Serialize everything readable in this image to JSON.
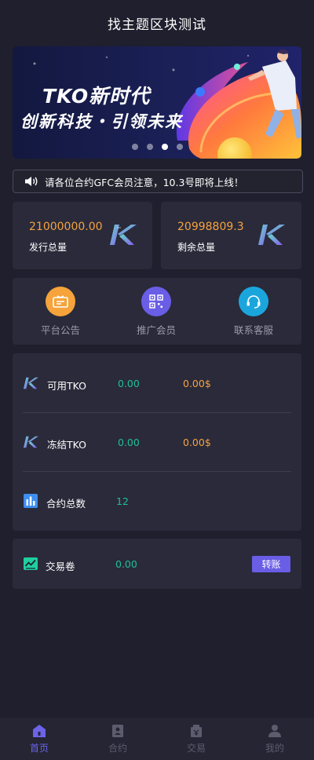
{
  "header": {
    "title": "找主题区块测试"
  },
  "banner": {
    "line1": "TKO新时代",
    "line2": "创新科技・引领未来",
    "slides": 4,
    "active_slide": 3
  },
  "notice": {
    "icon": "speaker-icon",
    "text": "请各位合约GFC会员注意，10.3号即将上线！"
  },
  "stats": [
    {
      "value": "21000000.00",
      "label": "发行总量",
      "icon": "tko-logo-icon"
    },
    {
      "value": "20998809.3",
      "label": "剩余总量",
      "icon": "tko-logo-icon"
    }
  ],
  "menu": [
    {
      "label": "平台公告",
      "icon": "announcement-icon",
      "color": "#f5a33a"
    },
    {
      "label": "推广会员",
      "icon": "qrcode-icon",
      "color": "#6a5de6"
    },
    {
      "label": "联系客服",
      "icon": "headset-icon",
      "color": "#1aa6dd"
    }
  ],
  "assets": {
    "available": {
      "name": "可用TKO",
      "amount": "0.00",
      "usd": "0.00$"
    },
    "frozen": {
      "name": "冻结TKO",
      "amount": "0.00",
      "usd": "0.00$"
    },
    "contracts": {
      "name": "合约总数",
      "count": "12"
    }
  },
  "voucher": {
    "name": "交易卷",
    "amount": "0.00",
    "button": "转账"
  },
  "tabs": [
    {
      "label": "首页",
      "icon": "home-icon",
      "active": true
    },
    {
      "label": "合约",
      "icon": "contract-icon",
      "active": false
    },
    {
      "label": "交易",
      "icon": "trade-icon",
      "active": false
    },
    {
      "label": "我的",
      "icon": "user-icon",
      "active": false
    }
  ],
  "colors": {
    "background": "#1f1f2e",
    "card": "#2a2a3a",
    "accent": "#6d63e8",
    "orange": "#f5a340",
    "green": "#1fbf9a"
  }
}
